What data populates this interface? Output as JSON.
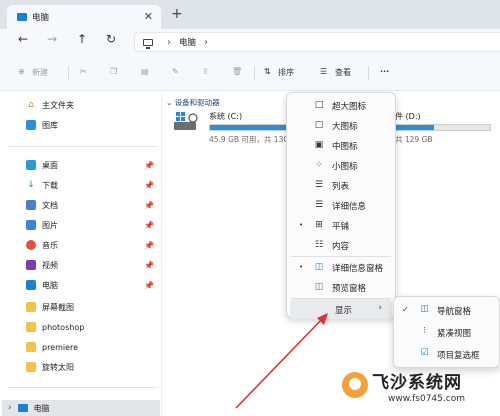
{
  "window": {
    "tab_title": "电脑",
    "new_tab": "+",
    "close": "✕"
  },
  "address": {
    "back": "←",
    "forward": "→",
    "up": "↑",
    "refresh": "↻",
    "location": "电脑",
    "chevron": "›"
  },
  "toolbar": {
    "new_label": "新建",
    "sort_label": "排序",
    "view_label": "查看",
    "more": "···"
  },
  "sidebar": {
    "top_items": [
      {
        "label": "主文件夹",
        "icon": "home-icon"
      },
      {
        "label": "图库",
        "icon": "gallery-icon"
      }
    ],
    "quick_items": [
      {
        "label": "桌面",
        "icon": "desktop-icon"
      },
      {
        "label": "下载",
        "icon": "download-icon"
      },
      {
        "label": "文档",
        "icon": "document-icon"
      },
      {
        "label": "图片",
        "icon": "pictures-icon"
      },
      {
        "label": "音乐",
        "icon": "music-icon"
      },
      {
        "label": "视频",
        "icon": "video-icon"
      },
      {
        "label": "电脑",
        "icon": "computer-icon"
      },
      {
        "label": "屏幕截图",
        "icon": "folder-icon"
      },
      {
        "label": "photoshop",
        "icon": "folder-icon"
      },
      {
        "label": "premiere",
        "icon": "folder-icon"
      },
      {
        "label": "旋转太阳",
        "icon": "folder-icon"
      }
    ],
    "bottom_item": "电脑",
    "bottom_chevron": "›"
  },
  "main": {
    "group_header": "设备和驱动器",
    "drives": [
      {
        "name": "系统 (C:)",
        "info": "45.9 GB 可用，共 130",
        "used_fraction": 0.65
      },
      {
        "name": "件 (D:)",
        "info": "共 129 GB",
        "used_fraction": 0.4
      }
    ]
  },
  "view_menu": {
    "items": [
      {
        "label": "超大图标",
        "icon": "□",
        "dot": ""
      },
      {
        "label": "大图标",
        "icon": "□",
        "dot": ""
      },
      {
        "label": "中图标",
        "icon": "▣",
        "dot": ""
      },
      {
        "label": "小图标",
        "icon": "⁘",
        "dot": ""
      },
      {
        "label": "列表",
        "icon": "☰",
        "dot": ""
      },
      {
        "label": "详细信息",
        "icon": "☰",
        "dot": ""
      },
      {
        "label": "平铺",
        "icon": "⊞",
        "dot": "•"
      },
      {
        "label": "内容",
        "icon": "☷",
        "dot": ""
      },
      {
        "label": "详细信息窗格",
        "icon": "◫",
        "dot": "•"
      },
      {
        "label": "预览窗格",
        "icon": "◫",
        "dot": ""
      },
      {
        "label": "显示",
        "icon": "",
        "dot": "",
        "arrow": "›"
      }
    ]
  },
  "show_submenu": {
    "items": [
      {
        "label": "导航窗格",
        "icon": "◫",
        "checked": "✓"
      },
      {
        "label": "紧凑视图",
        "icon": "⁝",
        "checked": ""
      },
      {
        "label": "项目复选框",
        "icon": "☑",
        "checked": ""
      }
    ]
  },
  "watermark": {
    "title": "飞沙系统网",
    "url": "www.fs0745.com"
  },
  "colors": {
    "accent": "#2a8fd8",
    "annotation_arrow": "#e0312e",
    "tab_strip": "#dfe4ea",
    "chrome": "#f6f8fb"
  }
}
